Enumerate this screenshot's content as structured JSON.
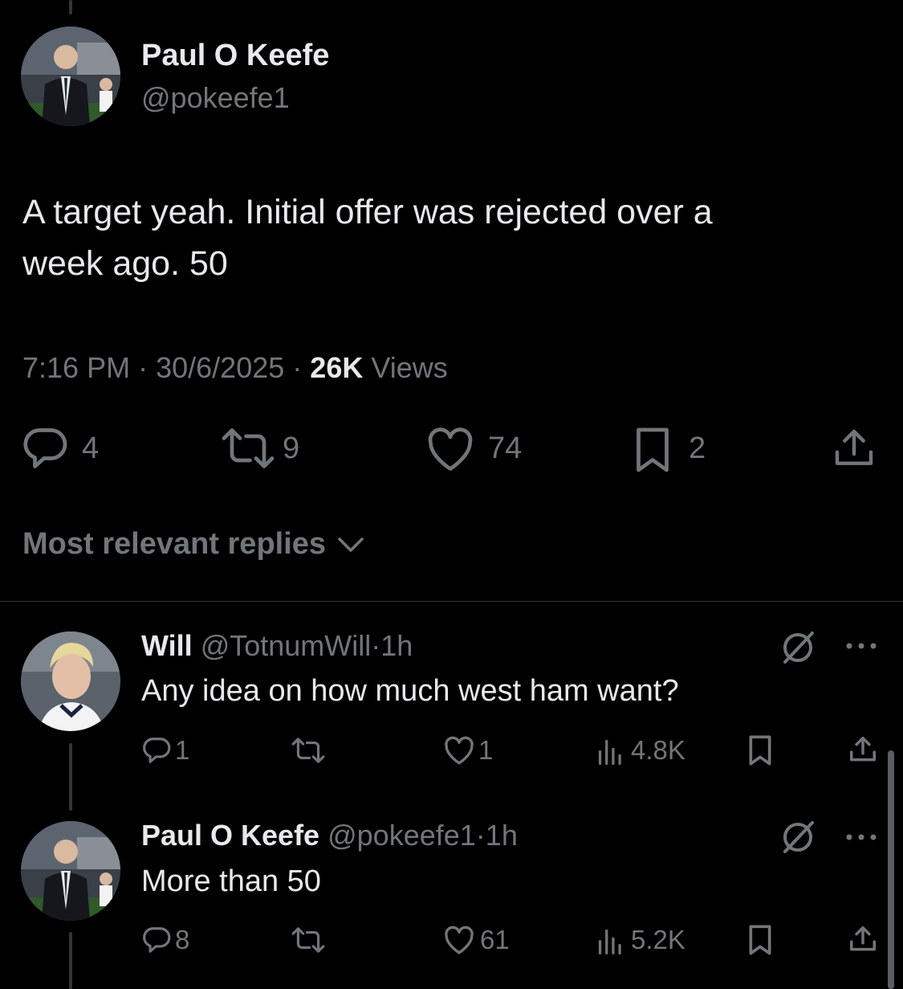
{
  "main_tweet": {
    "author_name": "Paul O Keefe",
    "handle": "@pokeefe1",
    "text_line1": "A target yeah. Initial offer was rejected over a",
    "text_line2": "week ago. 50",
    "time": "7:16 PM",
    "sep1": "·",
    "date": "30/6/2025",
    "sep2": "·",
    "views_count": "26K",
    "views_label": "Views",
    "replies": "4",
    "reposts": "9",
    "likes": "74",
    "bookmarks": "2"
  },
  "sort": {
    "label": "Most relevant replies"
  },
  "replies": [
    {
      "author_name": "Will",
      "handle": "@TotnumWill",
      "dot": "·",
      "time": "1h",
      "text": "Any idea on how much west ham want?",
      "replies": "1",
      "likes": "1",
      "views": "4.8K"
    },
    {
      "author_name": "Paul O Keefe",
      "handle": "@pokeefe1",
      "dot": "·",
      "time": "1h",
      "text": "More than 50",
      "replies": "8",
      "likes": "61",
      "views": "5.2K"
    }
  ],
  "colors": {
    "background": "#000000",
    "text": "#e7e9ea",
    "secondary": "#71767b",
    "divider": "#2f3336"
  }
}
